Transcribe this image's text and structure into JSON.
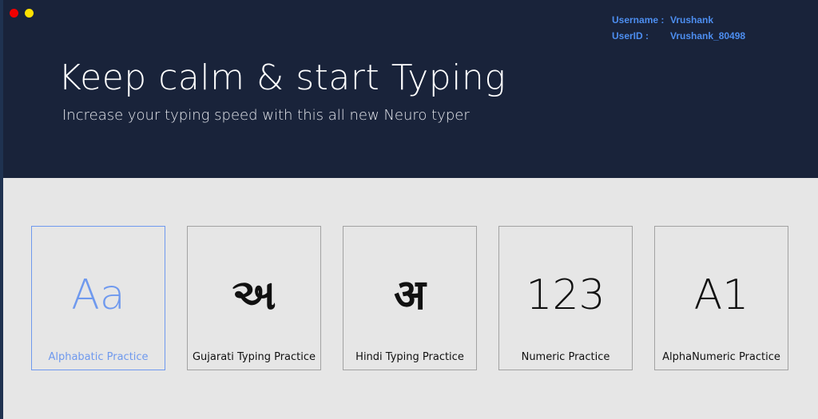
{
  "user": {
    "username_label": "Username :",
    "username_value": "Vrushank",
    "userid_label": "UserID :",
    "userid_value": "Vrushank_80498"
  },
  "header": {
    "title": "Keep calm & start Typing",
    "subtitle": "Increase your typing speed with this all new Neuro typer"
  },
  "cards": [
    {
      "glyph": "Aa",
      "label": "Alphabatic Practice",
      "selected": true
    },
    {
      "glyph": "અ",
      "label": "Gujarati Typing Practice",
      "selected": false
    },
    {
      "glyph": "अ",
      "label": "Hindi Typing Practice",
      "selected": false
    },
    {
      "glyph": "123",
      "label": "Numeric Practice",
      "selected": false
    },
    {
      "glyph": "A1",
      "label": "AlphaNumeric Practice",
      "selected": false
    }
  ],
  "colors": {
    "header_bg": "#19233a",
    "content_bg": "#e6e6e6",
    "accent": "#6f99ee",
    "user_info": "#4d8ef0",
    "close_dot": "#f00000",
    "minimize_dot": "#ffe100"
  }
}
